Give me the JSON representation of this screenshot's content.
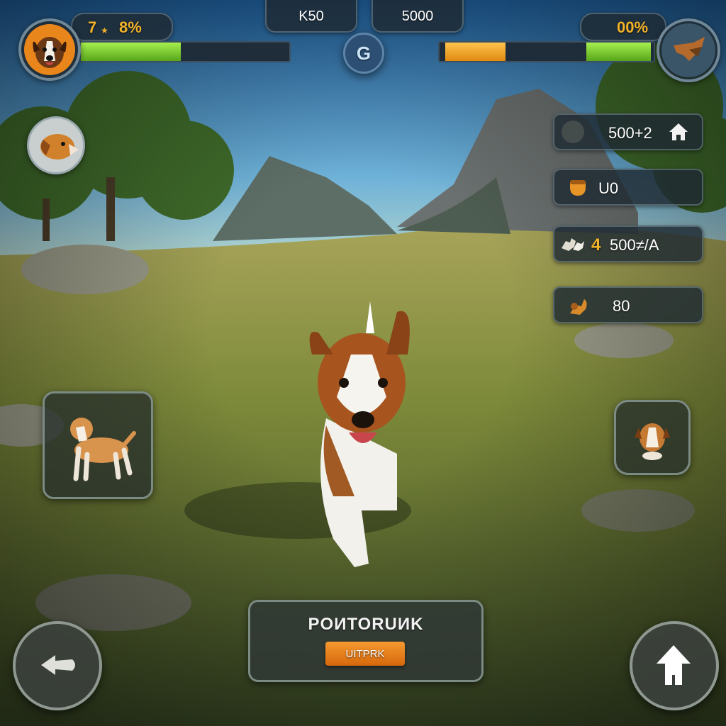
{
  "hud": {
    "player_level": "7",
    "player_percent": "8%",
    "player_progress": 0.48,
    "stat_left": "K50",
    "stat_right": "5000",
    "center_button": "G",
    "opponent_label": "00%",
    "opponent_bar_orange": 0.28,
    "opponent_bar_green": 0.3
  },
  "resources": [
    {
      "value": "500+2",
      "icon": "home-icon"
    },
    {
      "value": "U0",
      "icon": "acorn-icon"
    },
    {
      "prefix": "4",
      "value": "500≠/A",
      "icon": "dogs-icon"
    },
    {
      "value": "80",
      "icon": "squirrel-icon"
    }
  ],
  "action_panel": {
    "title": "POИТОRUИK",
    "button": "UITPRK"
  },
  "colors": {
    "accent_orange": "#e8811c",
    "bar_green": "#79d12e",
    "bar_orange": "#f3a51c",
    "panel_bg": "#1e2a32"
  }
}
